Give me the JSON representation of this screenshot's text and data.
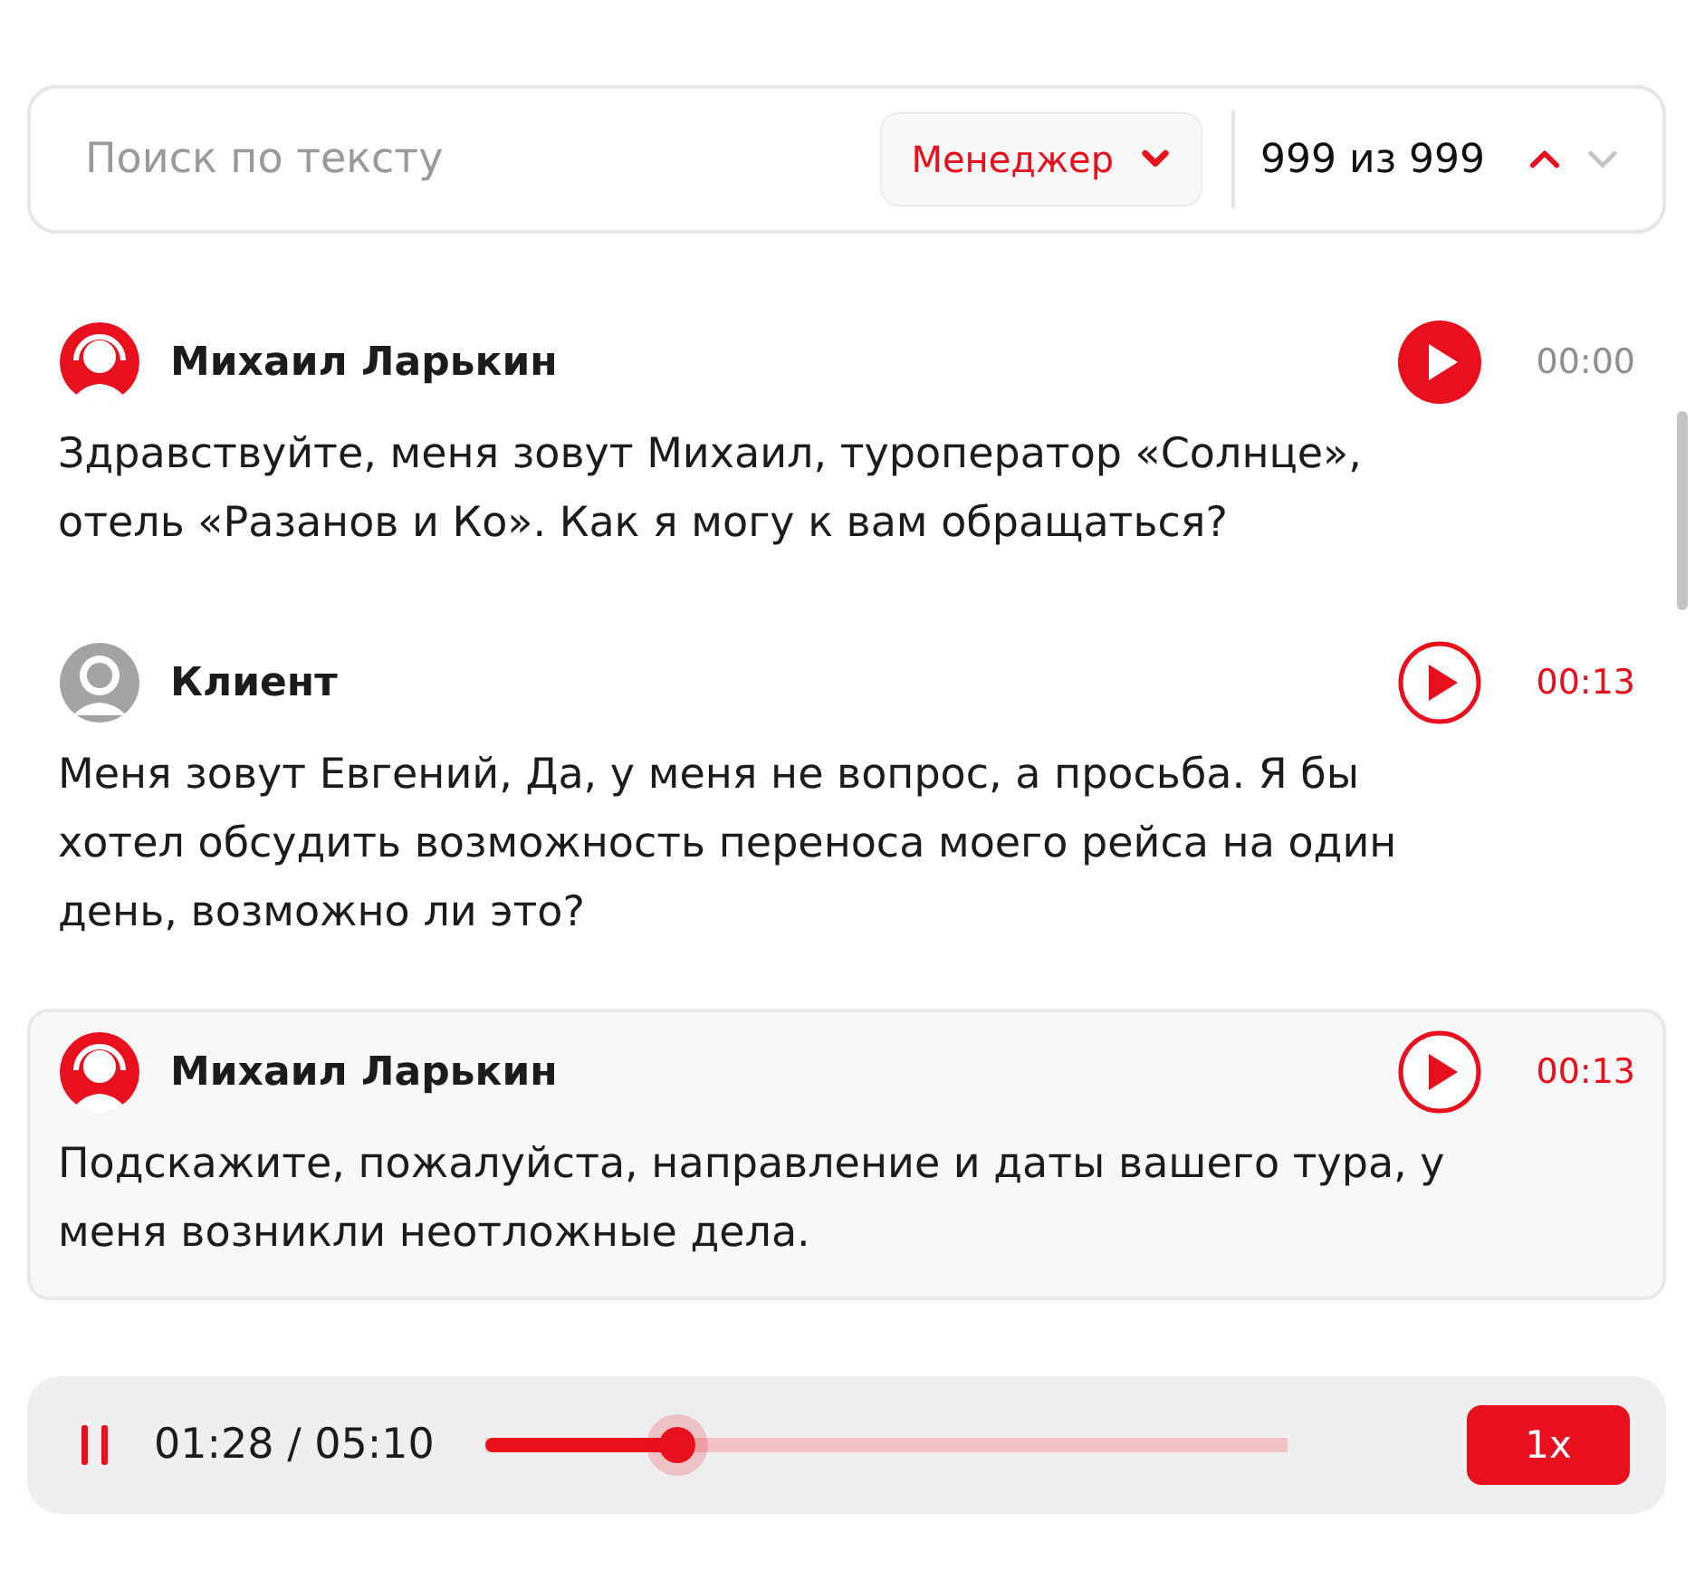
{
  "search": {
    "placeholder": "Поиск по тексту"
  },
  "filter": {
    "label": "Менеджер"
  },
  "matches": {
    "counter": "999 из 999",
    "up_disabled": false,
    "down_disabled": true
  },
  "messages": [
    {
      "kind": "manager",
      "name": "Михаил Ларькин",
      "time": "00:00",
      "playing": true,
      "selected": false,
      "text": "Здравствуйте, меня зовут Михаил, туроператор «Солнце», отель «Разанов и Ко». Как я могу к вам обращаться?"
    },
    {
      "kind": "client",
      "name": "Клиент",
      "time": "00:13",
      "playing": false,
      "selected": false,
      "text": "Меня зовут Евгений, Да, у меня не вопрос, а просьба. Я бы хотел обсудить возможность переноса моего рейса на один день, возможно ли это?"
    },
    {
      "kind": "manager",
      "name": "Михаил Ларькин",
      "time": "00:13",
      "playing": false,
      "selected": true,
      "text": "Подскажите, пожалуйста, направление и даты вашего тура, у меня возникли неотложные дела."
    }
  ],
  "player": {
    "playing": true,
    "time": "01:28 / 05:10",
    "level": 0.24,
    "speed": "1x"
  }
}
